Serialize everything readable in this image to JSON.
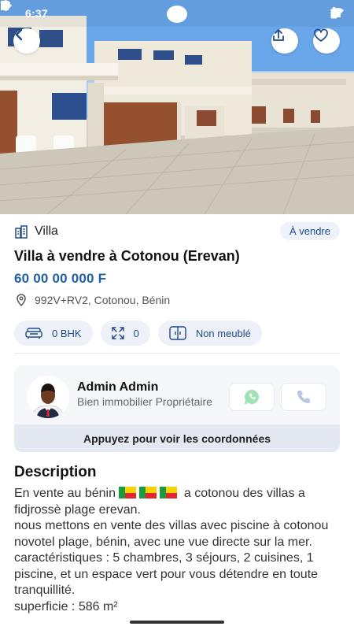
{
  "status_bar": {
    "time": "6:37"
  },
  "hero": {
    "image_alt": "Photo of villas"
  },
  "property": {
    "type": "Villa",
    "badge": "À vendre",
    "title": "Villa à vendre à Cotonou (Erevan)",
    "price": "60 00 00 000 F",
    "address": "992V+RV2, Cotonou, Bénin"
  },
  "features": [
    {
      "icon": "sofa-icon",
      "label": "0 BHK"
    },
    {
      "icon": "expand-icon",
      "label": "0"
    },
    {
      "icon": "wardrobe-icon",
      "label": "Non meublé"
    }
  ],
  "agent": {
    "name": "Admin Admin",
    "role": "Bien immobilier Propriétaire",
    "reveal_label": "Appuyez pour voir les coordonnées"
  },
  "description": {
    "heading": "Description",
    "line1_before_flags": "En vente au bénin",
    "line1_after_flags": "a cotonou des villas a fidjrossè plage erevan.",
    "line2": "nous mettons en vente des villas avec piscine à cotonou novotel plage, bénin, avec une vue directe sur la mer.",
    "line3": "caractéristiques  : 5 chambres, 3 séjours, 2 cuisines, 1 piscine, et un espace vert pour vous détendre en toute tranquillité.",
    "line4": "superficie : 586 m²"
  },
  "colors": {
    "accent": "#1f5fa8",
    "chip_bg": "#eef2f8",
    "card_bg": "#f5f7fb",
    "whatsapp": "#25d366"
  }
}
